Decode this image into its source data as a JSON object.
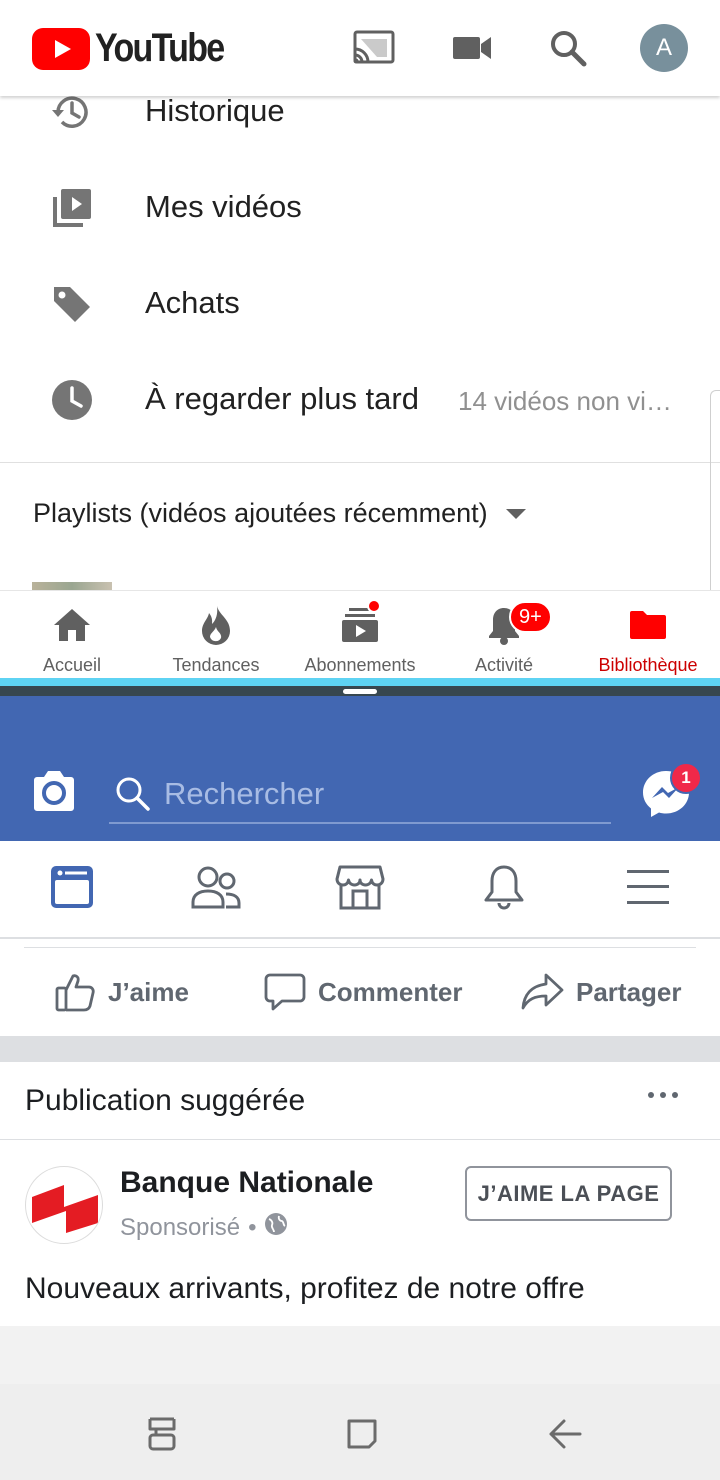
{
  "youtube": {
    "logo_text": "YouTube",
    "avatar_letter": "A",
    "menu": [
      {
        "label": "Historique",
        "icon": "history-icon"
      },
      {
        "label": "Mes vidéos",
        "icon": "my-videos-icon"
      },
      {
        "label": "Achats",
        "icon": "tag-icon"
      },
      {
        "label": "À regarder plus tard",
        "icon": "clock-icon",
        "sub": "14 vidéos non vi…"
      }
    ],
    "playlists_label": "Playlists (vidéos ajoutées récemment)",
    "bottom_nav": [
      {
        "label": "Accueil",
        "icon": "home-icon"
      },
      {
        "label": "Tendances",
        "icon": "trending-fire-icon"
      },
      {
        "label": "Abonnements",
        "icon": "subscriptions-icon"
      },
      {
        "label": "Activité",
        "icon": "bell-icon",
        "badge": "9+"
      },
      {
        "label": "Bibliothèque",
        "icon": "library-folder-icon",
        "active": true
      }
    ],
    "brand_color": "#ff0000"
  },
  "facebook": {
    "search_placeholder": "Rechercher",
    "messenger_badge": "1",
    "actions": {
      "like": "J’aime",
      "comment": "Commenter",
      "share": "Partager"
    },
    "suggested_title": "Publication suggérée",
    "page_name": "Banque Nationale",
    "sponsored": "Sponsorisé",
    "sponsored_sep": "•",
    "like_page_button": "J’AIME LA PAGE",
    "post_text": "Nouveaux arrivants, profitez de notre offre",
    "brand_color": "#4267b2"
  }
}
